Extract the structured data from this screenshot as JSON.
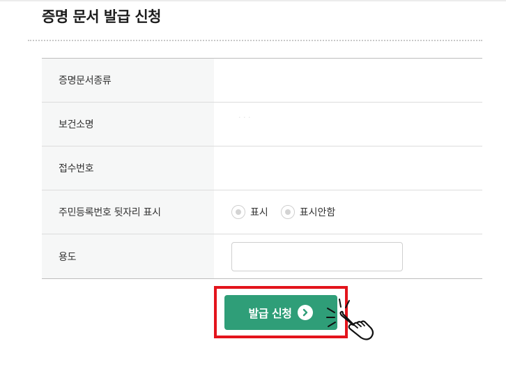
{
  "page": {
    "title": "증명 문서 발급 신청"
  },
  "form": {
    "rows": [
      {
        "label": "증명문서종류",
        "value": ""
      },
      {
        "label": "보건소명",
        "value": "· · ·"
      },
      {
        "label": "접수번호",
        "value": ""
      },
      {
        "label": "주민등록번호 뒷자리 표시"
      },
      {
        "label": "용도"
      }
    ],
    "radio_options": [
      {
        "label": "표시",
        "selected": false
      },
      {
        "label": "표시안함",
        "selected": false
      }
    ],
    "purpose_input": {
      "value": "",
      "placeholder": ""
    }
  },
  "submit": {
    "label": "발급 신청",
    "icon": "chevron-right-circle-icon"
  },
  "colors": {
    "button_green": "#2f9e78",
    "highlight_red": "#e3141c",
    "label_background": "#f6f7f7"
  },
  "decorations": {
    "pointer": "hand-pointer-icon"
  }
}
